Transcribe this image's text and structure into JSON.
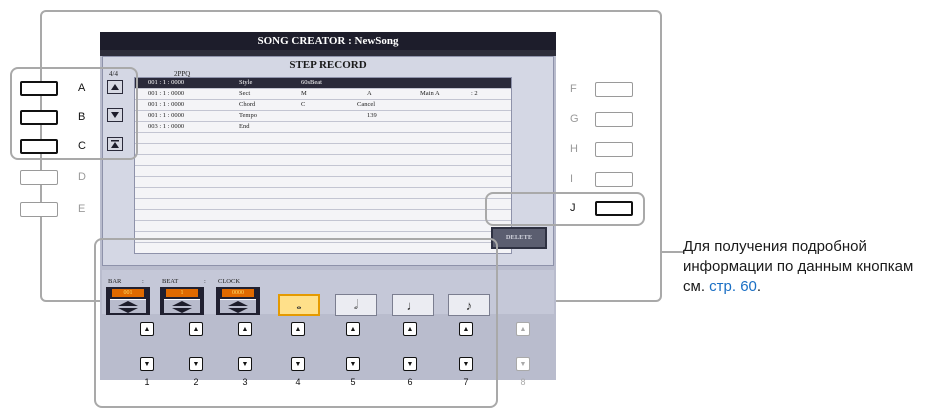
{
  "screen": {
    "title": "SONG CREATOR : NewSong",
    "panel_title": "STEP RECORD",
    "time_signature": "4/4",
    "ppq": "2PPQ",
    "rows": [
      {
        "pos": "001 : 1 : 0000",
        "event": "Style",
        "v1": "60sBeat",
        "v2": "",
        "v3": "",
        "v4": ""
      },
      {
        "pos": "001 : 1 : 0000",
        "event": "Sect",
        "v1": "M",
        "v2": "A",
        "v3": "Main A",
        "v4": ": 2"
      },
      {
        "pos": "001 : 1 : 0000",
        "event": "Chord",
        "v1": "C",
        "v2": "Cancel",
        "v3": "",
        "v4": ""
      },
      {
        "pos": "001 : 1 : 0000",
        "event": "Tempo",
        "v1": "",
        "v2": "139",
        "v3": "",
        "v4": ""
      },
      {
        "pos": "003 : 1 : 0000",
        "event": "End",
        "v1": "",
        "v2": "",
        "v3": "",
        "v4": ""
      }
    ],
    "delete_label": "DELETE",
    "bar_label": "BAR",
    "beat_label": "BEAT",
    "clock_label": "CLOCK",
    "sep": ":",
    "bar_value": "001",
    "beat_value": "1",
    "clock_value": "0000",
    "notes": [
      "whole-note",
      "half-note",
      "quarter-note",
      "eighth-note"
    ],
    "note_glyphs": [
      "𝅝",
      "𝅗𝅥",
      "♩",
      "♪"
    ],
    "selected_note": 0
  },
  "side_left": [
    "A",
    "B",
    "C",
    "D",
    "E"
  ],
  "side_right": [
    "F",
    "G",
    "H",
    "I",
    "J"
  ],
  "bottom_numbers": [
    "1",
    "2",
    "3",
    "4",
    "5",
    "6",
    "7",
    "8"
  ],
  "description": {
    "text": "Для получения подробной информации по данным кнопкам см.",
    "link": "стр. 60",
    "tail": "."
  },
  "colors": {
    "accent_orange": "#e06a00",
    "link_blue": "#1a6fc4",
    "callout_gray": "#a9a9a9"
  }
}
